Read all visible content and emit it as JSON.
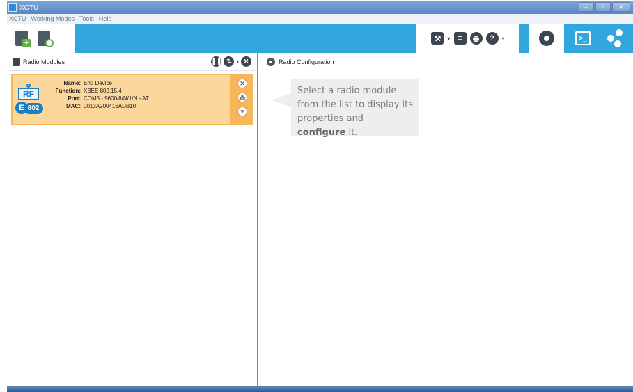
{
  "window": {
    "title": "XCTU",
    "controls": {
      "minimize": "–",
      "maximize": "▫",
      "close": "X"
    }
  },
  "menu": [
    "XCTU",
    "Working Modes",
    "Tools",
    "Help"
  ],
  "toolbar": {
    "tool_icons": [
      "tools-icon",
      "frames-icon",
      "discovery-icon",
      "help-icon"
    ],
    "active_tab": "configuration"
  },
  "left_panel": {
    "title": "Radio Modules",
    "module": {
      "name_label": "Name:",
      "name": "End Device",
      "function_label": "Function:",
      "function": "XBEE 802.15.4",
      "port_label": "Port:",
      "port": "COM5 - 9600/8/N/1/N - AT",
      "mac_label": "MAC:",
      "mac": "0013A200416ADB10",
      "logo": {
        "rf": "RF",
        "e": "E",
        "protocol": "802"
      }
    }
  },
  "right_panel": {
    "title": "Radio Configuration",
    "hint_part1": "Select a radio module from the list to display its properties and ",
    "hint_bold": "configure",
    "hint_part2": " it."
  },
  "colors": {
    "accent": "#31a7dd",
    "card": "#f6b65a",
    "card_inner": "#fcd79c"
  }
}
